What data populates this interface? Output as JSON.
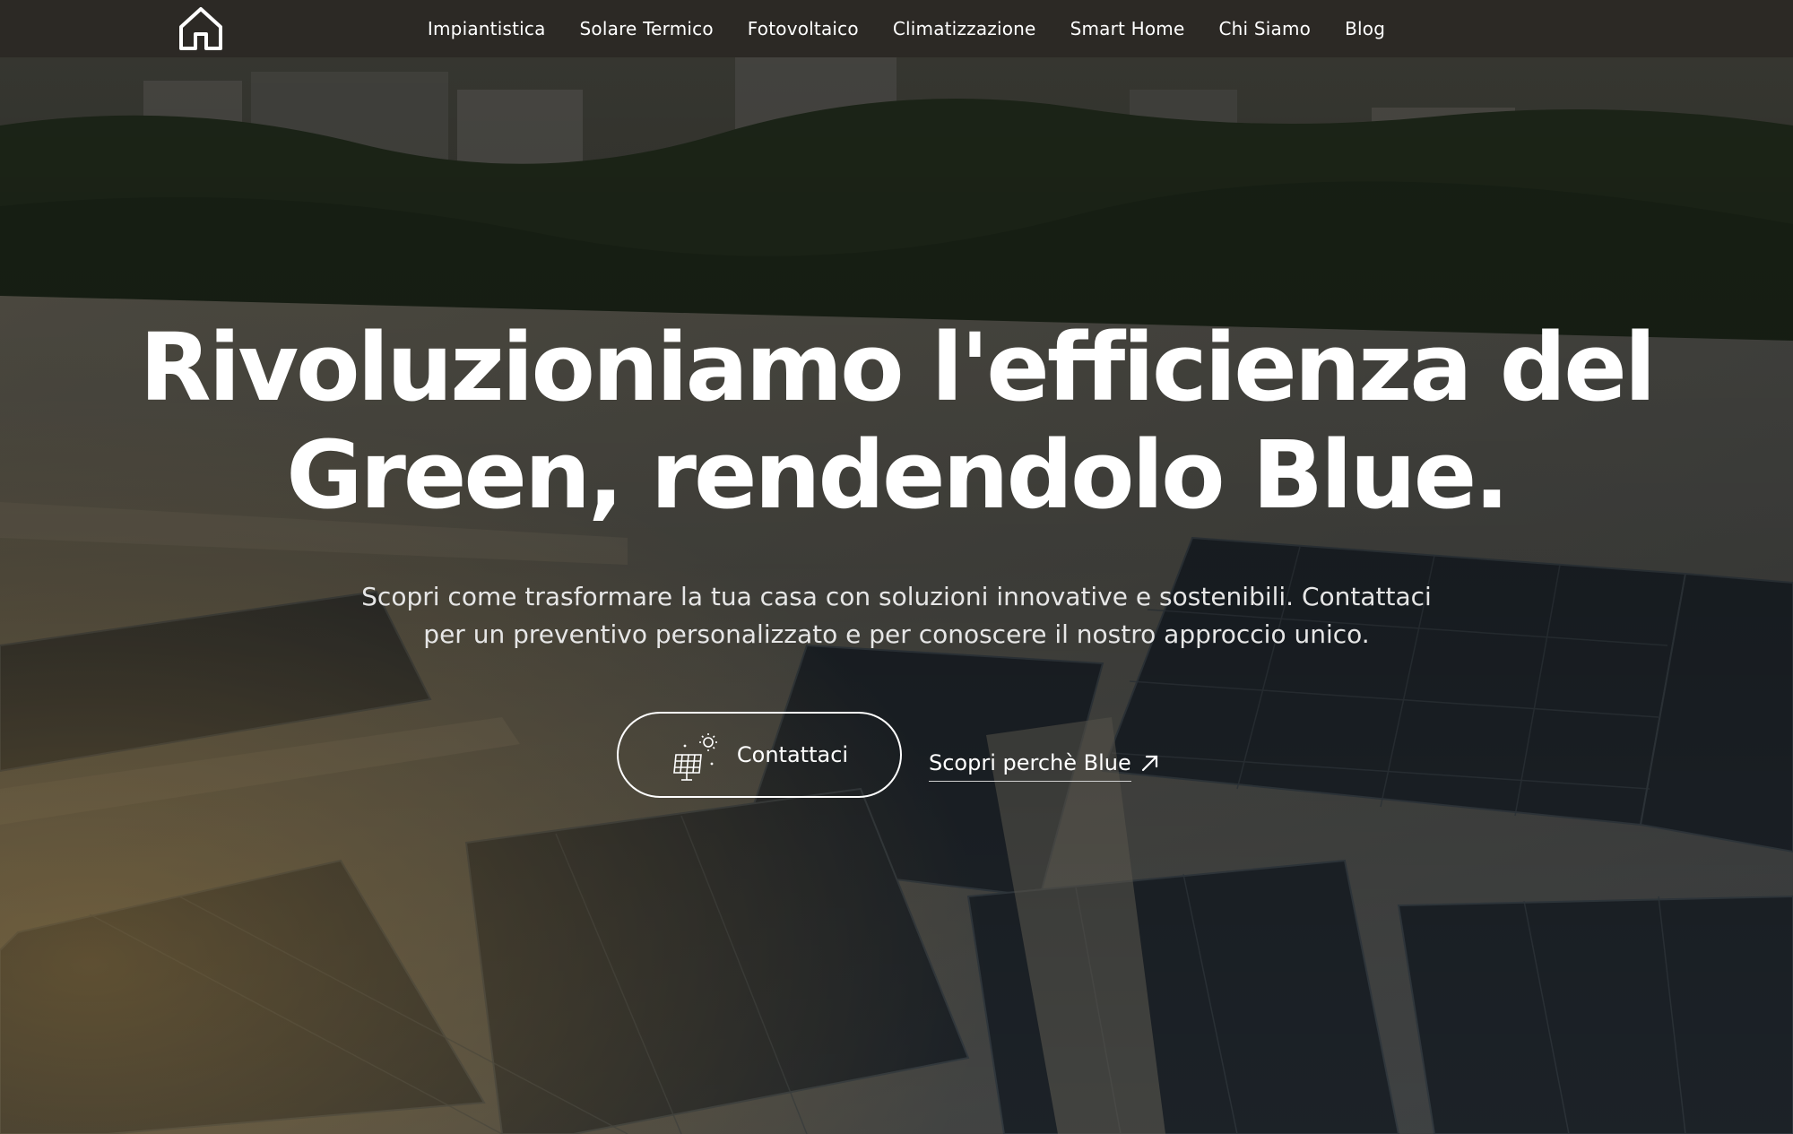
{
  "nav": {
    "logo_icon": "house-icon",
    "items": [
      {
        "label": "Impiantistica"
      },
      {
        "label": "Solare Termico"
      },
      {
        "label": "Fotovoltaico"
      },
      {
        "label": "Climatizzazione"
      },
      {
        "label": "Smart Home"
      },
      {
        "label": "Chi Siamo"
      },
      {
        "label": "Blog"
      }
    ]
  },
  "hero": {
    "title_line1": "Rivoluzioniamo l'efficienza del",
    "title_line2": "Green, rendendolo Blue.",
    "subtitle_line1": "Scopri come trasformare la tua casa con soluzioni innovative e sostenibili. Contattaci",
    "subtitle_line2": "per un preventivo personalizzato e per conoscere il nostro approccio unico.",
    "background_image": "solar-panel-rooftop-photo",
    "primary_cta": {
      "label": "Contattaci",
      "icon": "solar-panel-icon"
    },
    "secondary_cta": {
      "label": "Scopri perchè Blue",
      "icon": "arrow-up-right-icon"
    }
  },
  "colors": {
    "navbar_bg": "#2c2925",
    "text": "#ffffff",
    "subtitle_text": "#e6e6e6"
  }
}
